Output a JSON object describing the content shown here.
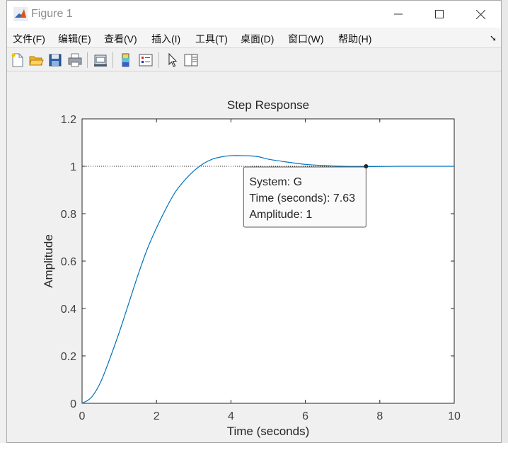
{
  "window": {
    "title": "Figure 1"
  },
  "menu": {
    "items": [
      "文件(F)",
      "编辑(E)",
      "查看(V)",
      "插入(I)",
      "工具(T)",
      "桌面(D)",
      "窗口(W)",
      "帮助(H)"
    ]
  },
  "toolbar": {
    "buttons": [
      "new-figure-icon",
      "open-file-icon",
      "save-icon",
      "print-icon",
      "link-plot-icon",
      "colorbar-icon",
      "legend-icon",
      "edit-plot-arrow-icon",
      "property-editor-icon"
    ]
  },
  "colors": {
    "line": "#0072bd",
    "title_icon": "#d95319"
  },
  "chart_data": {
    "type": "line",
    "title": "Step Response",
    "xlabel": "Time (seconds)",
    "ylabel": "Amplitude",
    "xlim": [
      0,
      10
    ],
    "ylim": [
      0,
      1.2
    ],
    "xticks": [
      "0",
      "2",
      "4",
      "6",
      "8",
      "10"
    ],
    "yticks": [
      "0",
      "0.2",
      "0.4",
      "0.6",
      "0.8",
      "1",
      "1.2"
    ],
    "reference_line": 1,
    "series": [
      {
        "x": [
          0,
          0.25,
          0.5,
          0.75,
          1,
          1.25,
          1.5,
          1.75,
          2,
          2.25,
          2.5,
          2.75,
          3,
          3.25,
          3.5,
          3.75,
          4,
          4.25,
          4.5,
          4.75,
          5,
          5.5,
          6,
          6.5,
          7,
          7.5,
          8,
          8.5,
          9,
          9.5,
          10
        ],
        "values": [
          0,
          0.025,
          0.09,
          0.19,
          0.3,
          0.42,
          0.54,
          0.65,
          0.74,
          0.82,
          0.89,
          0.94,
          0.98,
          1.01,
          1.03,
          1.04,
          1.045,
          1.045,
          1.044,
          1.04,
          1.03,
          1.018,
          1.008,
          1.003,
          1.0,
          0.999,
          0.999,
          1.0,
          1.0,
          1.0,
          1.0
        ]
      }
    ],
    "datatip": {
      "x": 7.63,
      "y": 1,
      "lines": [
        "System: G",
        "Time (seconds): 7.63",
        "Amplitude: 1"
      ]
    }
  }
}
